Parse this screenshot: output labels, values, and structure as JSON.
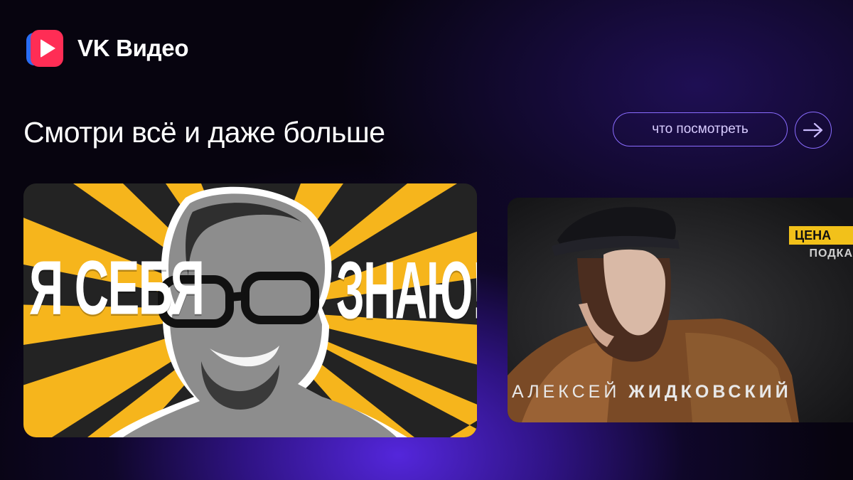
{
  "brand": {
    "name": "VK Видео",
    "logo_icon": "vk-video-play-icon",
    "colors": {
      "red": "#ff2d55",
      "blue": "#2a6df4"
    }
  },
  "headline": "Смотри всё и даже больше",
  "actions": {
    "watch_label": "что посмотреть",
    "next_icon": "arrow-right-icon",
    "accent": "#8a6cff"
  },
  "cards": {
    "main": {
      "word_left": "Я СЕБЯ",
      "word_right": "ЗНАЮ!",
      "accent": "#f6b51c"
    },
    "side": {
      "badge": "ЦЕНА",
      "badge_sub": "ПОДКА",
      "caption_first": "АЛЕКСЕЙ",
      "caption_last": "ЖИДКОВСКИЙ"
    }
  }
}
